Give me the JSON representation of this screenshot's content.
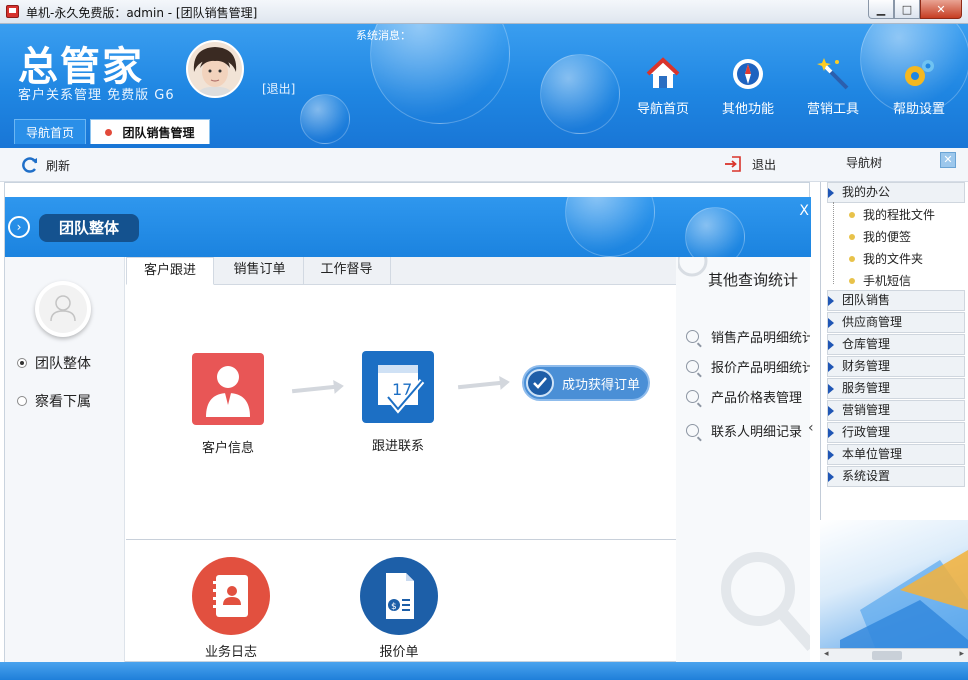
{
  "window": {
    "title": "单机-永久免费版：admin - [团队销售管理]",
    "buttons": {
      "minimize": "▁",
      "maximize": "□",
      "close": "✕"
    }
  },
  "header": {
    "logo": "总管家",
    "subtitle": "客户关系管理  免费版  G6",
    "logout": "[退出]",
    "system_message": "系统消息：",
    "tools": [
      {
        "label": "导航首页",
        "icon": "home-icon"
      },
      {
        "label": "其他功能",
        "icon": "compass-icon"
      },
      {
        "label": "营销工具",
        "icon": "magic-wand-icon"
      },
      {
        "label": "帮助设置",
        "icon": "gears-icon"
      }
    ],
    "tabs": [
      {
        "label": "导航首页"
      },
      {
        "label": "团队销售管理"
      }
    ]
  },
  "toolbar": {
    "refresh": "刷新",
    "exit": "退出",
    "nav_tree": "导航树",
    "close": "✕"
  },
  "band": {
    "title": "团队整体",
    "close": "X"
  },
  "left_panel": {
    "options": [
      {
        "label": "团队整体",
        "selected": true
      },
      {
        "label": "察看下属",
        "selected": false
      }
    ]
  },
  "center": {
    "tabs": [
      "客户跟进",
      "销售订单",
      "工作督导"
    ],
    "flow": [
      {
        "label": "客户信息",
        "color": "#e85656"
      },
      {
        "label": "跟进联系",
        "color": "#1c6fc4"
      }
    ],
    "success": "成功获得订单",
    "bottom": [
      {
        "label": "业务日志",
        "color": "#e2503f"
      },
      {
        "label": "报价单",
        "color": "#1d5fa8"
      }
    ]
  },
  "right_panel": {
    "title": "其他查询统计",
    "items": [
      "销售产品明细统计",
      "报价产品明细统计",
      "产品价格表管理",
      "联系人明细记录"
    ],
    "collapse": "‹"
  },
  "nav_tree": {
    "groups": [
      {
        "label": "我的办公",
        "children": [
          "我的程批文件",
          "我的便签",
          "我的文件夹",
          "手机短信"
        ]
      },
      {
        "label": "团队销售"
      },
      {
        "label": "供应商管理"
      },
      {
        "label": "仓库管理"
      },
      {
        "label": "财务管理"
      },
      {
        "label": "服务管理"
      },
      {
        "label": "营销管理"
      },
      {
        "label": "行政管理"
      },
      {
        "label": "本单位管理"
      },
      {
        "label": "系统设置"
      }
    ],
    "scroll_left": "◂",
    "scroll_right": "▸"
  },
  "colors": {
    "brand_blue": "#1f86e2",
    "dark_blue": "#14528f",
    "red": "#e85656"
  }
}
